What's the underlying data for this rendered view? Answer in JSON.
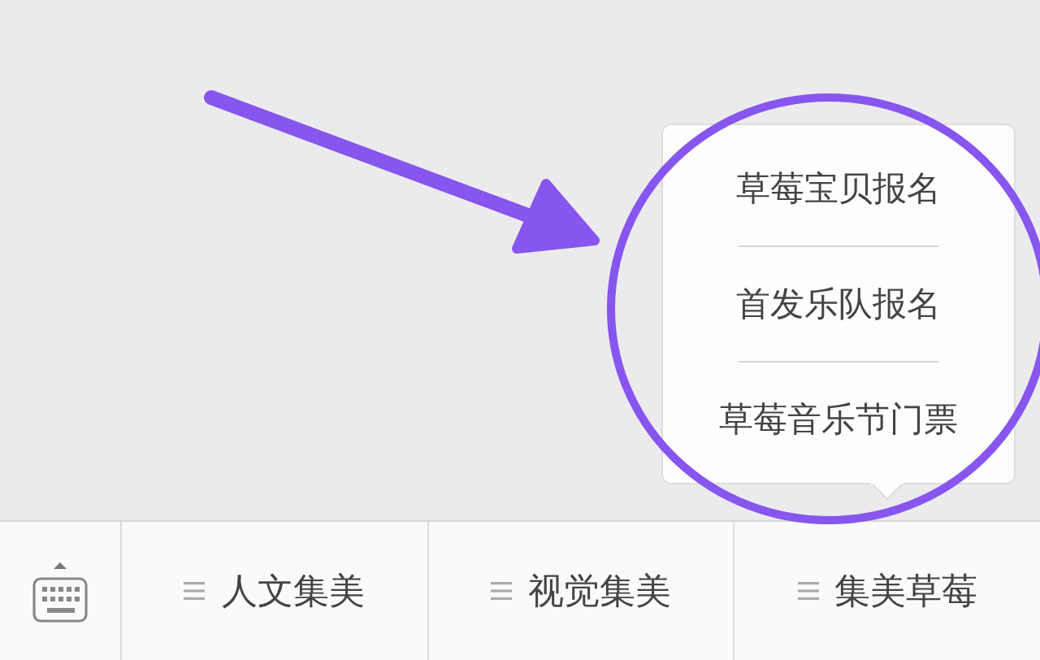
{
  "menu_bar": {
    "items": [
      {
        "label": "人文集美"
      },
      {
        "label": "视觉集美"
      },
      {
        "label": "集美草莓"
      }
    ]
  },
  "submenu": {
    "items": [
      {
        "label": "草莓宝贝报名"
      },
      {
        "label": "首发乐队报名"
      },
      {
        "label": "草莓音乐节门票"
      }
    ]
  }
}
